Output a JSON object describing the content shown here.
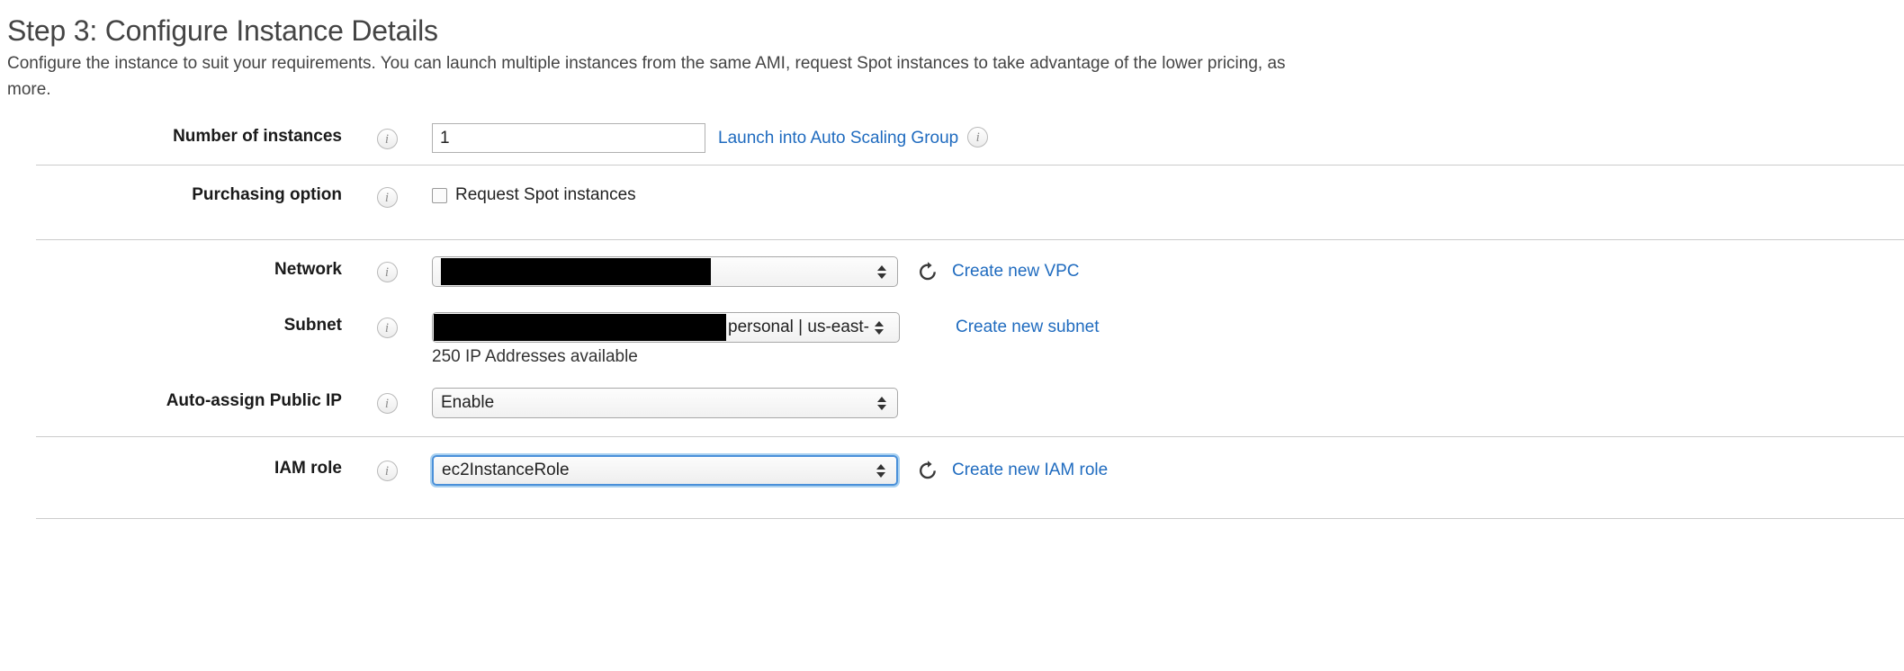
{
  "header": {
    "title": "Step 3: Configure Instance Details",
    "description_line1": "Configure the instance to suit your requirements. You can launch multiple instances from the same AMI, request Spot instances to take advantage of the lower pricing, as",
    "description_line2": "more."
  },
  "colors": {
    "link": "#1f6bbf",
    "focus_ring": "#4a90d9",
    "divider": "#cccccc",
    "redaction": "#000000"
  },
  "form": {
    "number_of_instances": {
      "label": "Number of instances",
      "info_icon": "info-icon",
      "value": "1",
      "link_label": "Launch into Auto Scaling Group",
      "link_info_icon": "info-icon"
    },
    "purchasing_option": {
      "label": "Purchasing option",
      "info_icon": "info-icon",
      "checkbox_label": "Request Spot instances",
      "checked": false
    },
    "network": {
      "label": "Network",
      "info_icon": "info-icon",
      "value": "",
      "redacted": true,
      "refresh_icon": "refresh-icon",
      "link_label": "Create new VPC"
    },
    "subnet": {
      "label": "Subnet",
      "info_icon": "info-icon",
      "value_visible": "personal | us-east-",
      "redacted": true,
      "helper_text": "250 IP Addresses available",
      "link_label": "Create new subnet"
    },
    "auto_assign_public_ip": {
      "label": "Auto-assign Public IP",
      "info_icon": "info-icon",
      "value": "Enable"
    },
    "iam_role": {
      "label": "IAM role",
      "info_icon": "info-icon",
      "value": "ec2InstanceRole",
      "focused": true,
      "refresh_icon": "refresh-icon",
      "link_label": "Create new IAM role"
    }
  }
}
